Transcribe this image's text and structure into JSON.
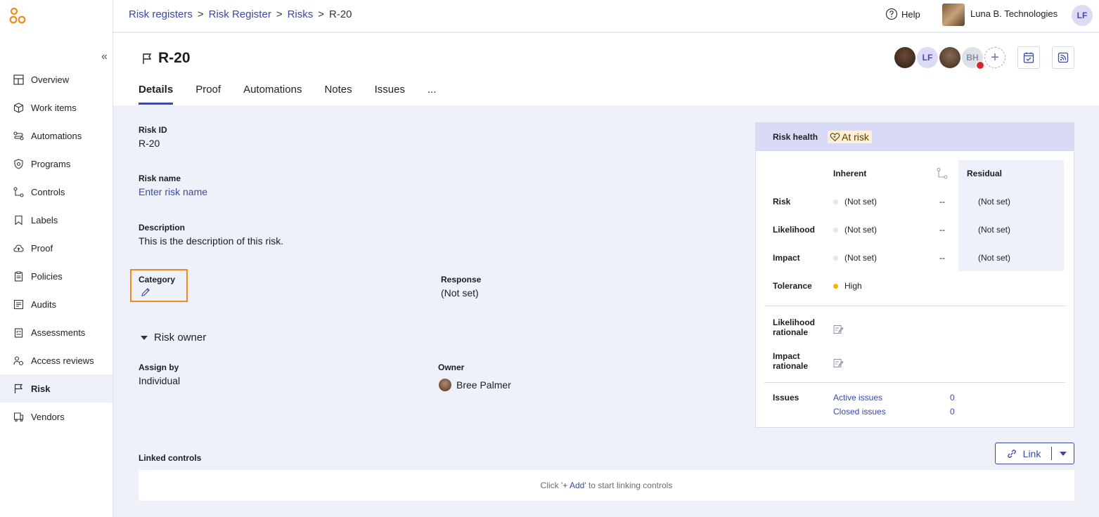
{
  "sidebar": {
    "items": [
      {
        "label": "Overview",
        "icon": "overview-icon"
      },
      {
        "label": "Work items",
        "icon": "cube-icon"
      },
      {
        "label": "Automations",
        "icon": "automations-icon"
      },
      {
        "label": "Programs",
        "icon": "shield-icon"
      },
      {
        "label": "Controls",
        "icon": "controls-icon"
      },
      {
        "label": "Labels",
        "icon": "bookmark-icon"
      },
      {
        "label": "Proof",
        "icon": "cloud-icon"
      },
      {
        "label": "Policies",
        "icon": "clipboard-icon"
      },
      {
        "label": "Audits",
        "icon": "audit-icon"
      },
      {
        "label": "Assessments",
        "icon": "assessment-icon"
      },
      {
        "label": "Access reviews",
        "icon": "access-review-icon"
      },
      {
        "label": "Risk",
        "icon": "flag-icon",
        "active": true
      },
      {
        "label": "Vendors",
        "icon": "vendor-icon"
      }
    ]
  },
  "topbar": {
    "breadcrumbs": [
      "Risk registers",
      "Risk Register",
      "Risks",
      "R-20"
    ],
    "separator": ">",
    "help": "Help",
    "org_name": "Luna B. Technologies",
    "user_initials": "LF"
  },
  "header": {
    "title": "R-20",
    "tabs": [
      "Details",
      "Proof",
      "Automations",
      "Notes",
      "Issues",
      "..."
    ],
    "active_tab": "Details",
    "avatar_initials": [
      "LF",
      "BH"
    ],
    "add_symbol": "+"
  },
  "details": {
    "risk_id_label": "Risk ID",
    "risk_id": "R-20",
    "risk_name_label": "Risk name",
    "risk_name_placeholder": "Enter risk name",
    "description_label": "Description",
    "description": "This is the description of this risk.",
    "category_label": "Category",
    "response_label": "Response",
    "response": "(Not set)",
    "risk_owner_label": "Risk owner",
    "assign_by_label": "Assign by",
    "assign_by": "Individual",
    "owner_label": "Owner",
    "owner": "Bree Palmer"
  },
  "risk_health": {
    "label": "Risk health",
    "status": "At risk",
    "inherent_label": "Inherent",
    "residual_label": "Residual",
    "rows": [
      {
        "label": "Risk",
        "inherent": "(Not set)",
        "mid": "--",
        "residual": "(Not set)"
      },
      {
        "label": "Likelihood",
        "inherent": "(Not set)",
        "mid": "--",
        "residual": "(Not set)"
      },
      {
        "label": "Impact",
        "inherent": "(Not set)",
        "mid": "--",
        "residual": "(Not set)"
      }
    ],
    "tolerance_label": "Tolerance",
    "tolerance": "High",
    "likelihood_rationale_1": "Likelihood",
    "likelihood_rationale_2": "rationale",
    "impact_rationale_1": "Impact",
    "impact_rationale_2": "rationale",
    "issues_label": "Issues",
    "active_issues_label": "Active issues",
    "active_issues_count": "0",
    "closed_issues_label": "Closed issues",
    "closed_issues_count": "0",
    "colors": {
      "tolerance_high": "#f7b500",
      "status_bg": "#fdf0d7"
    }
  },
  "linked_controls": {
    "label": "Linked controls",
    "link_button": "Link",
    "empty_prefix": "Click '",
    "empty_action": "+ Add",
    "empty_suffix": "' to start linking controls"
  }
}
